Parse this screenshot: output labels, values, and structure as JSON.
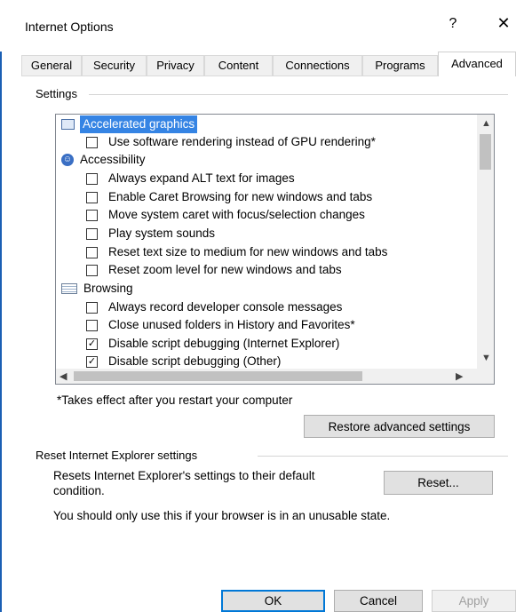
{
  "window": {
    "title": "Internet Options",
    "help_glyph": "?",
    "close_glyph": "✕"
  },
  "tabs": [
    {
      "label": "General",
      "active": false
    },
    {
      "label": "Security",
      "active": false
    },
    {
      "label": "Privacy",
      "active": false
    },
    {
      "label": "Content",
      "active": false
    },
    {
      "label": "Connections",
      "active": false
    },
    {
      "label": "Programs",
      "active": false
    },
    {
      "label": "Advanced",
      "active": true
    }
  ],
  "settings": {
    "group_label": "Settings",
    "items": [
      {
        "kind": "category",
        "label": "Accelerated graphics",
        "icon": "monitor-icon",
        "selected": true
      },
      {
        "kind": "checkbox",
        "label": "Use software rendering instead of GPU rendering*",
        "checked": false
      },
      {
        "kind": "category",
        "label": "Accessibility",
        "icon": "accessibility-icon",
        "selected": false
      },
      {
        "kind": "checkbox",
        "label": "Always expand ALT text for images",
        "checked": false
      },
      {
        "kind": "checkbox",
        "label": "Enable Caret Browsing for new windows and tabs",
        "checked": false
      },
      {
        "kind": "checkbox",
        "label": "Move system caret with focus/selection changes",
        "checked": false
      },
      {
        "kind": "checkbox",
        "label": "Play system sounds",
        "checked": false
      },
      {
        "kind": "checkbox",
        "label": "Reset text size to medium for new windows and tabs",
        "checked": false
      },
      {
        "kind": "checkbox",
        "label": "Reset zoom level for new windows and tabs",
        "checked": false
      },
      {
        "kind": "category",
        "label": "Browsing",
        "icon": "page-icon",
        "selected": false
      },
      {
        "kind": "checkbox",
        "label": "Always record developer console messages",
        "checked": false
      },
      {
        "kind": "checkbox",
        "label": "Close unused folders in History and Favorites*",
        "checked": false
      },
      {
        "kind": "checkbox",
        "label": "Disable script debugging (Internet Explorer)",
        "checked": true
      },
      {
        "kind": "checkbox",
        "label": "Disable script debugging (Other)",
        "checked": true
      }
    ],
    "restart_note": "*Takes effect after you restart your computer",
    "restore_button": "Restore advanced settings"
  },
  "reset_group": {
    "label": "Reset Internet Explorer settings",
    "description_line1": "Resets Internet Explorer's settings to their default",
    "description_line2": "condition.",
    "reset_button": "Reset...",
    "warning": "You should only use this if your browser is in an unusable state."
  },
  "footer": {
    "ok": "OK",
    "cancel": "Cancel",
    "apply": "Apply"
  },
  "colors": {
    "selection": "#3584e4",
    "focus_border": "#0078d7"
  }
}
